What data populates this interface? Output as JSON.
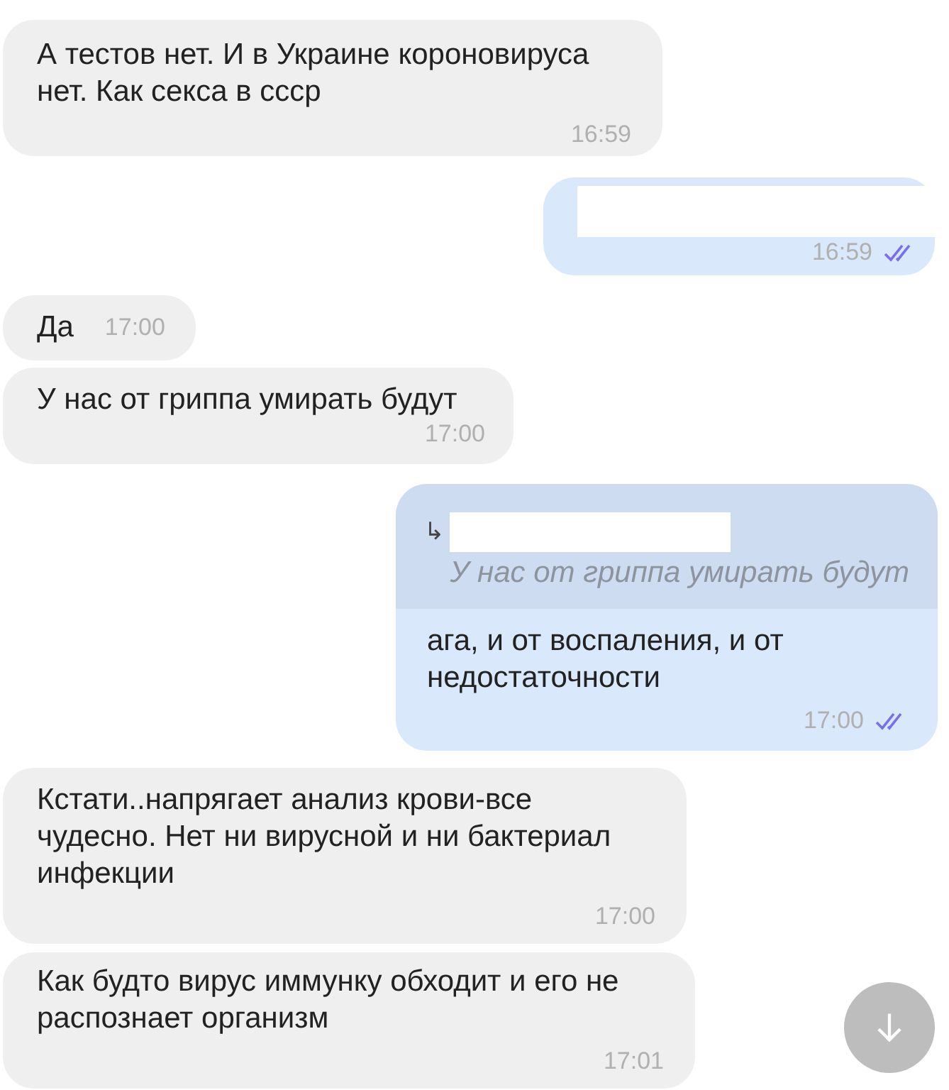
{
  "messages": [
    {
      "kind": "incoming",
      "text": "А тестов нет. И в Украине короновируса нет. Как секса в ссср",
      "time": "16:59"
    },
    {
      "kind": "outgoing",
      "redacted": true,
      "time": "16:59",
      "read": true
    },
    {
      "kind": "incoming-short",
      "text": "Да",
      "time": "17:00"
    },
    {
      "kind": "incoming",
      "text": "У нас от гриппа умирать будут",
      "time": "17:00"
    },
    {
      "kind": "outgoing-reply",
      "reply": {
        "arrow": "↳",
        "redacted": true,
        "quote": "У нас от гриппа умирать будут"
      },
      "text": "ага, и от воспаления, и от недостаточности",
      "time": "17:00",
      "read": true
    },
    {
      "kind": "incoming",
      "text": "Кстати..напрягает анализ крови-все чудесно. Нет ни вирусной и ни бактериал инфекции",
      "time": "17:00"
    },
    {
      "kind": "incoming",
      "text": "Как будто вирус иммунку обходит и его не распознает организм",
      "time": "17:01"
    }
  ]
}
